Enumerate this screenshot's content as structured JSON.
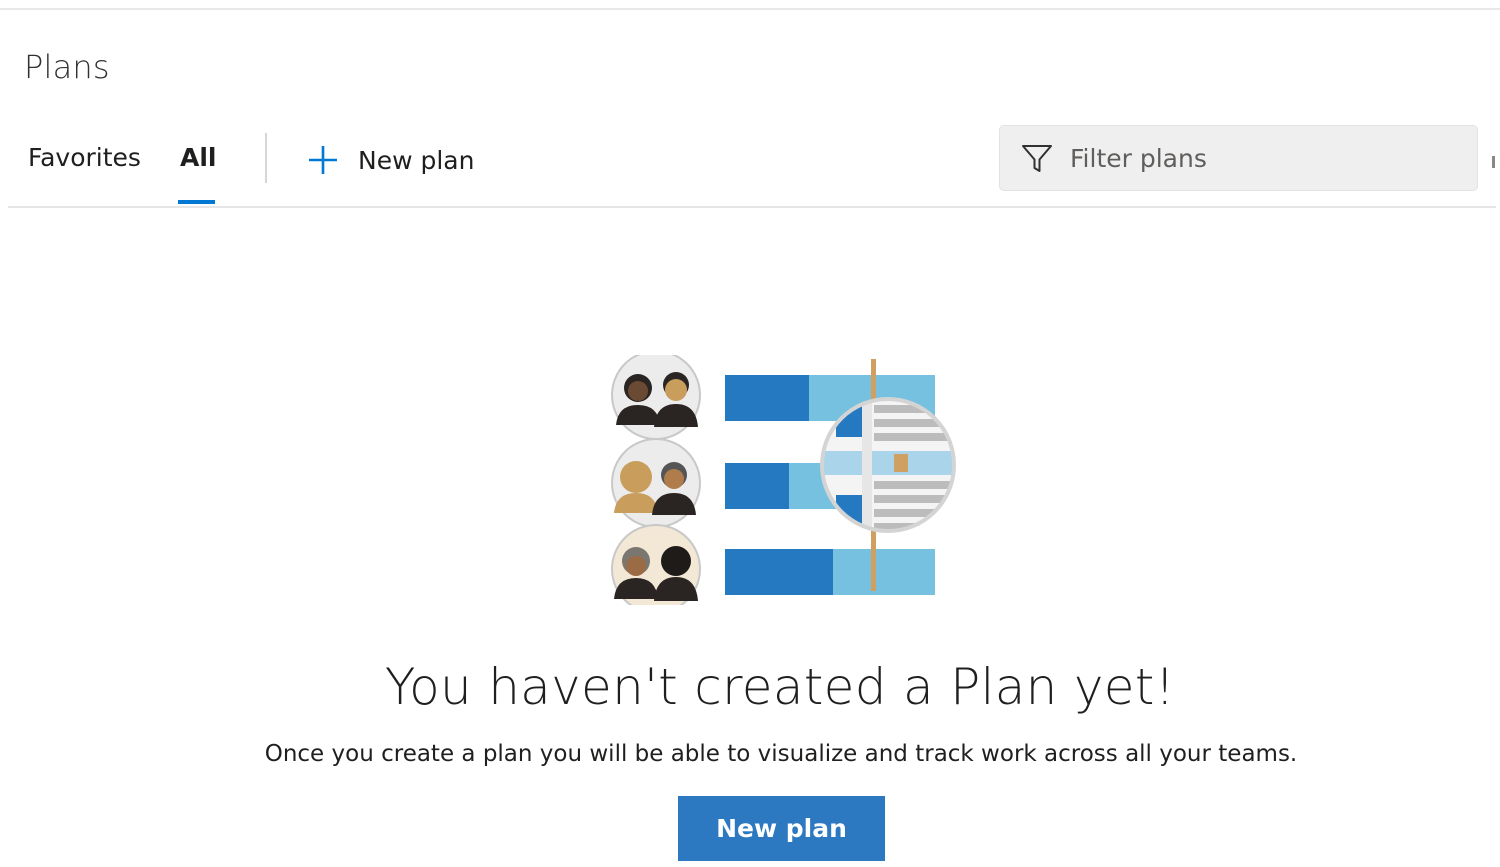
{
  "header": {
    "title": "Plans"
  },
  "toolbar": {
    "tabs": [
      {
        "label": "Favorites",
        "selected": false
      },
      {
        "label": "All",
        "selected": true
      }
    ],
    "new_plan_label": "New plan",
    "filter": {
      "placeholder": "Filter plans",
      "value": ""
    }
  },
  "empty_state": {
    "heading": "You haven't created a Plan yet!",
    "description": "Once you create a plan you will be able to visualize and track work across all your teams.",
    "button_label": "New plan"
  },
  "icons": {
    "new_plan": "plus-icon",
    "filter": "funnel-icon"
  },
  "colors": {
    "accent": "#0078d4",
    "primary_button": "#2c79c1",
    "bar_dark": "#2479c0",
    "bar_light": "#76c1df",
    "timeline_marker": "#d0a062"
  }
}
